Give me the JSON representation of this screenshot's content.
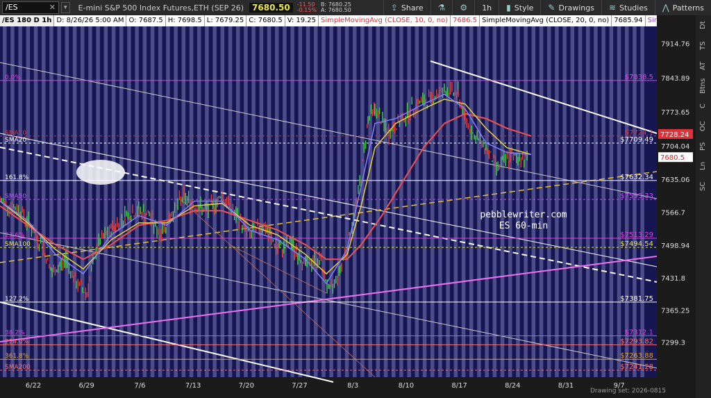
{
  "toolbar": {
    "symbol": "/ES",
    "description": "E-mini S&P 500 Index Futures,ETH (SEP 26)",
    "last": "7680.50",
    "change": "-11.50",
    "change_pct": "-0.15%",
    "bid": "B: 7680.25",
    "ask": "A: 7680.50",
    "share": "Share",
    "interval": "1h",
    "style": "Style",
    "drawings": "Drawings",
    "studies": "Studies",
    "patterns": "Patterns"
  },
  "legend": {
    "header": "/ES 180 D 1h",
    "date": "D: 8/26/26 5:00 AM",
    "open": "O: 7687.5",
    "high": "H: 7698.5",
    "low": "L: 7679.25",
    "close": "C: 7680.5",
    "volume": "V: 19.25",
    "sma10": "SimpleMovingAvg (CLOSE, 10, 0, no)",
    "sma10_val": "7686.5",
    "sma20": "SimpleMovingAvg (CLOSE, 20, 0, no)",
    "sma20_val": "7685.94",
    "sma50": "SimpleMovingAvg"
  },
  "sidebar_tabs": [
    "Dt",
    "TS",
    "AT",
    "Btns",
    "C",
    "OC",
    "PS",
    "Ln",
    "SC"
  ],
  "chart_data": {
    "type": "candlestick",
    "x_ticks": [
      "6/22",
      "6/29",
      "7/6",
      "7/13",
      "7/20",
      "7/27",
      "8/3",
      "8/10",
      "8/17",
      "8/24",
      "8/31",
      "9/7"
    ],
    "y_ticks": [
      7914.76,
      7843.89,
      7773.65,
      7704.04,
      7635.06,
      7566.7,
      7498.94,
      7431.8,
      7365.25,
      7299.3
    ],
    "ylim": [
      7227,
      7950
    ],
    "levels": [
      {
        "left": "0.0%",
        "right": "$7838.5",
        "value": 7838.5,
        "color": "#e040e0"
      },
      {
        "left": "SMA10",
        "right": "$7724.1",
        "value": 7724.1,
        "color": "#e0303a"
      },
      {
        "left": "SMA20",
        "right": "$7709.49",
        "value": 7709.49,
        "color": "#ffffff"
      },
      {
        "left": "161.8%",
        "right": "$7632.34",
        "value": 7632.34,
        "color": "#ffffff"
      },
      {
        "left": "SMA50",
        "right": "$7593.33",
        "value": 7593.33,
        "color": "#c050f0"
      },
      {
        "left": "23.6%",
        "right": "$7513.29",
        "value": 7513.29,
        "color": "#e040e0"
      },
      {
        "left": "SMA100",
        "right": "$7494.54",
        "value": 7494.54,
        "color": "#e8e84a"
      },
      {
        "left": "127.2%",
        "right": "$7381.75",
        "value": 7381.75,
        "color": "#ffffff"
      },
      {
        "left": "38.2%",
        "right": "$7312.1",
        "value": 7312.1,
        "color": "#e040e0"
      },
      {
        "left": "224.0%",
        "right": "$7293.82",
        "value": 7293.82,
        "color": "#ff7070"
      },
      {
        "left": "361.8%",
        "right": "$7263.88",
        "value": 7263.88,
        "color": "#e0a030"
      },
      {
        "left": "SMA200",
        "right": "$7241.28",
        "value": 7241.28,
        "color": "#ff7070"
      }
    ],
    "price_labels": [
      {
        "text": "7728.24",
        "value": 7728.24,
        "bg": "#e0303a"
      },
      {
        "text": "7680.5",
        "value": 7680.5,
        "bg": "#ffffff"
      }
    ],
    "watermark": [
      "pebblewriter.com",
      "ES 60-min"
    ]
  },
  "status": "Drawing set: 2026-0815"
}
